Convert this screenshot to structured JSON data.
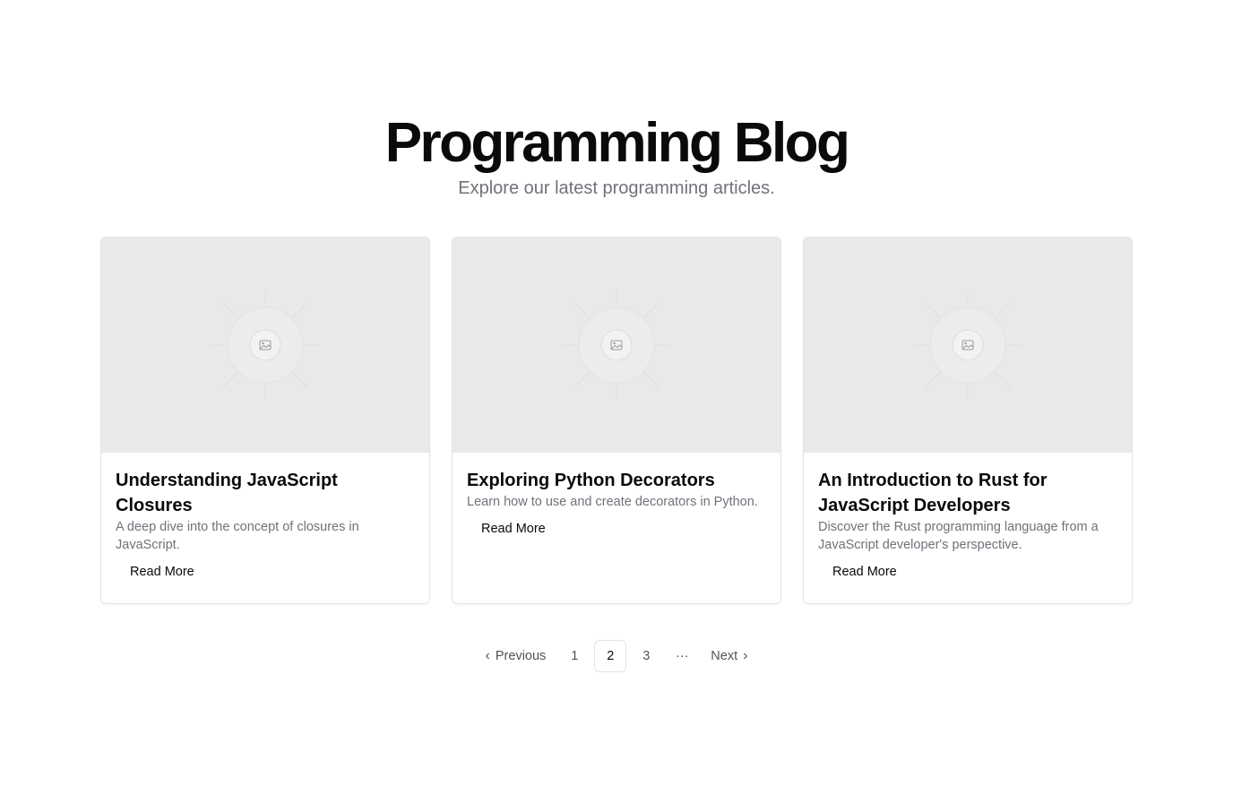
{
  "hero": {
    "title": "Programming Blog",
    "subtitle": "Explore our latest programming articles."
  },
  "posts": [
    {
      "title": "Understanding JavaScript Closures",
      "description": "A deep dive into the concept of closures in JavaScript.",
      "cta": "Read More",
      "image_icon": "image-placeholder-icon"
    },
    {
      "title": "Exploring Python Decorators",
      "description": "Learn how to use and create decorators in Python.",
      "cta": "Read More",
      "image_icon": "image-placeholder-icon"
    },
    {
      "title": "An Introduction to Rust for JavaScript Developers",
      "description": "Discover the Rust programming language from a JavaScript developer's perspective.",
      "cta": "Read More",
      "image_icon": "image-placeholder-icon"
    }
  ],
  "pagination": {
    "previous_label": "Previous",
    "next_label": "Next",
    "pages": [
      "1",
      "2",
      "3"
    ],
    "current_page": "2",
    "ellipsis": "···",
    "previous_icon": "chevron-left-icon",
    "next_icon": "chevron-right-icon"
  }
}
